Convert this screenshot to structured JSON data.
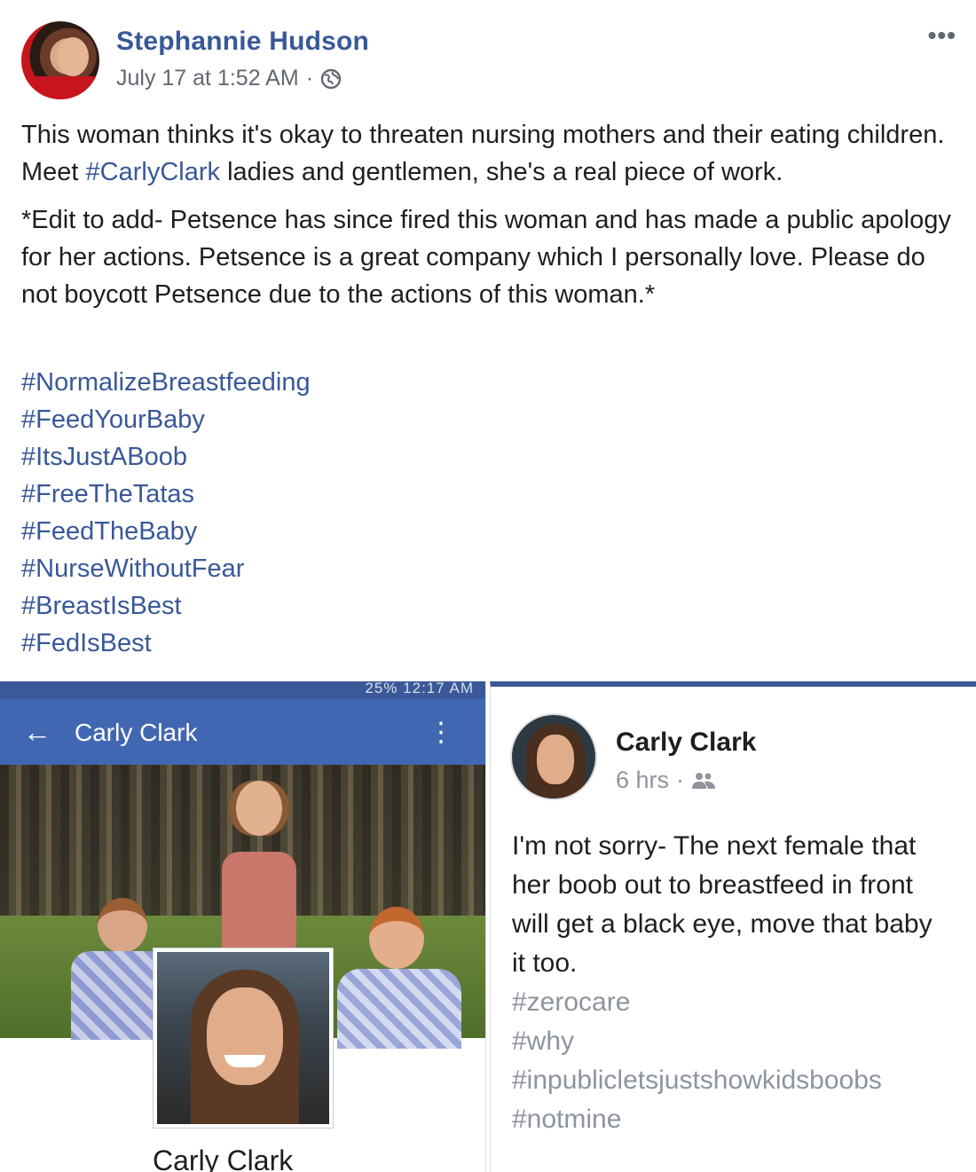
{
  "post": {
    "author": "Stephannie Hudson",
    "timestamp": "July 17 at 1:52 AM",
    "separator": "·",
    "privacy_icon": "globe-icon",
    "more_icon": "more-options-icon",
    "more_label": "•••",
    "text": {
      "line1": "This woman thinks it's okay to threaten nursing mothers and their eating children.",
      "line2_prefix": "Meet ",
      "line2_link": "#CarlyClark",
      "line2_suffix": " ladies and gentlemen, she's a real piece of work.",
      "edit_note": "*Edit to add- Petsence has since fired this woman and has made a public apology for her actions. Petsence is a great company which I personally love. Please do not boycott Petsence due to the actions of this woman.*"
    },
    "hashtags": [
      "#NormalizeBreastfeeding",
      "#FeedYourBaby",
      "#ItsJustABoob",
      "#FreeTheTatas",
      "#FeedTheBaby",
      "#NurseWithoutFear",
      "#BreastIsBest",
      "#FedIsBest"
    ]
  },
  "screenshot_profile": {
    "status_bar": "25% 12:17 AM",
    "back_icon": "back-arrow-icon",
    "back_label": "←",
    "title": "Carly Clark",
    "menu_icon": "kebab-menu-icon",
    "menu_label": "⋮",
    "profile_name": "Carly Clark"
  },
  "screenshot_post": {
    "name": "Carly Clark",
    "time": "6 hrs",
    "separator": "·",
    "audience_icon": "friends-icon",
    "lines": [
      "I'm not sorry- The next female that",
      "her boob out to breastfeed in front",
      "will get a black eye, move that baby",
      "it too."
    ],
    "hashtags": [
      "#zerocare",
      "#why",
      "#inpublicletsjustshowkidsboobs",
      "#notmine"
    ]
  },
  "colors": {
    "link": "#385898",
    "facebook_blue": "#4267b2",
    "muted_text": "#616770",
    "tag_gray": "#8d949e"
  }
}
